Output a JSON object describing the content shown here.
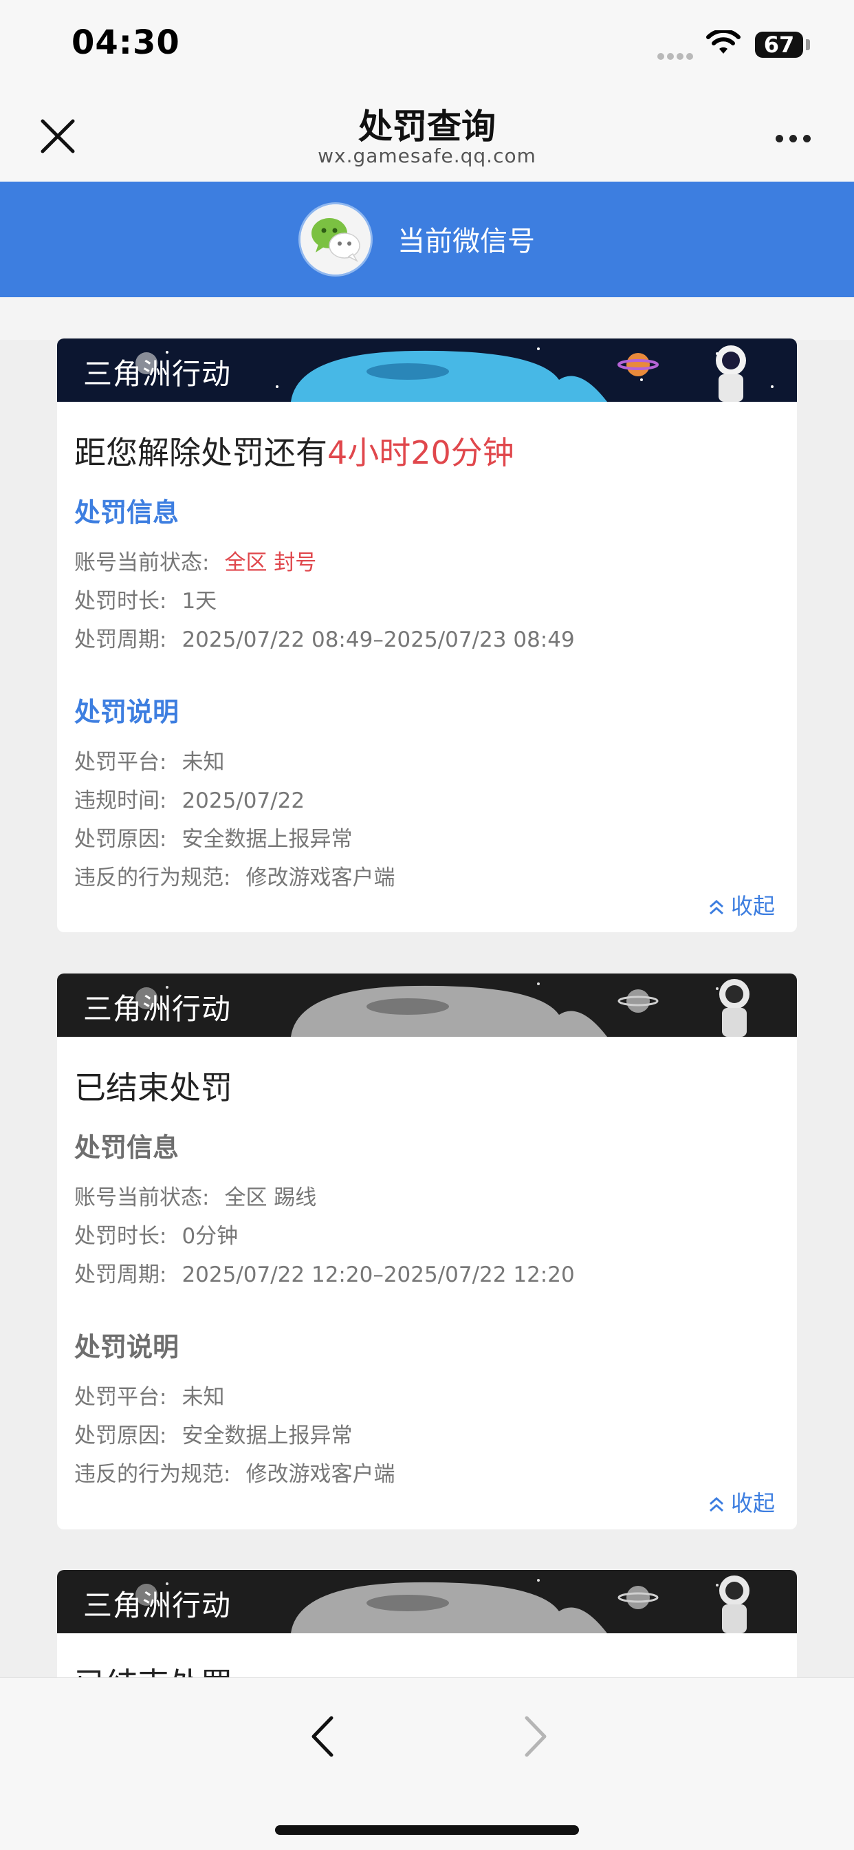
{
  "status_bar": {
    "time": "04:30",
    "battery": "67"
  },
  "nav": {
    "title": "处罚查询",
    "domain": "wx.gamesafe.qq.com"
  },
  "account": {
    "label": "当前微信号"
  },
  "cards": [
    {
      "game": "三角洲行动",
      "headline_prefix": "距您解除处罚还有",
      "headline_countdown": "4小时20分钟",
      "info_title": "处罚信息",
      "status_label": "账号当前状态:",
      "status_value": "全区 封号",
      "duration_label": "处罚时长:",
      "duration_value": "1天",
      "period_label": "处罚周期:",
      "period_value": "2025/07/22 08:49–2025/07/23 08:49",
      "desc_title": "处罚说明",
      "platform_label": "处罚平台:",
      "platform_value": "未知",
      "violation_time_label": "违规时间:",
      "violation_time_value": "2025/07/22",
      "reason_label": "处罚原因:",
      "reason_value": "安全数据上报异常",
      "rule_label": "违反的行为规范:",
      "rule_value": "修改游戏客户端",
      "collapse": "收起"
    },
    {
      "game": "三角洲行动",
      "headline": "已结束处罚",
      "info_title": "处罚信息",
      "status_label": "账号当前状态:",
      "status_value": "全区 踢线",
      "duration_label": "处罚时长:",
      "duration_value": "0分钟",
      "period_label": "处罚周期:",
      "period_value": "2025/07/22 12:20–2025/07/22 12:20",
      "desc_title": "处罚说明",
      "platform_label": "处罚平台:",
      "platform_value": "未知",
      "reason_label": "处罚原因:",
      "reason_value": "安全数据上报异常",
      "rule_label": "违反的行为规范:",
      "rule_value": "修改游戏客户端",
      "collapse": "收起"
    },
    {
      "game": "三角洲行动",
      "headline": "已结束处罚"
    }
  ],
  "icons": {
    "close": "close-icon",
    "more": "more-icon",
    "wechat": "wechat-icon",
    "collapse": "chevron-double-up-icon",
    "back": "chevron-left-icon",
    "forward": "chevron-right-icon"
  },
  "colors": {
    "accent_blue": "#3d7ee0",
    "alert_red": "#e0474c",
    "muted_gray": "#6e6e6e"
  }
}
